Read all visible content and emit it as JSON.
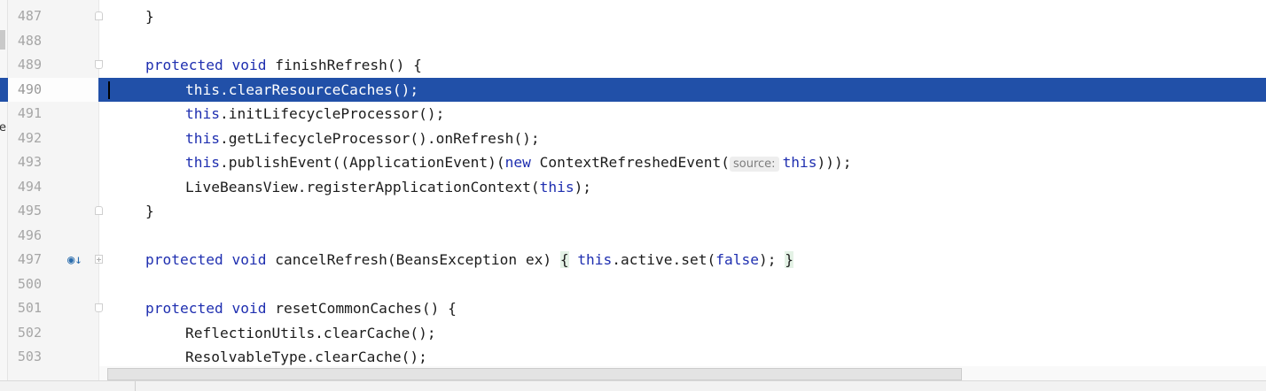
{
  "editor": {
    "lines": [
      {
        "num": "487",
        "fold": "close",
        "indent": 0,
        "tokens": [
          {
            "t": "}"
          }
        ]
      },
      {
        "num": "488",
        "fold": "",
        "indent": 0,
        "tokens": []
      },
      {
        "num": "489",
        "fold": "open",
        "indent": 0,
        "tokens": [
          {
            "t": "protected",
            "k": "kw"
          },
          {
            "t": " "
          },
          {
            "t": "void",
            "k": "kw"
          },
          {
            "t": " finishRefresh() {"
          }
        ]
      },
      {
        "num": "490",
        "fold": "",
        "indent": 1,
        "current": true,
        "tokens": [
          {
            "t": "this",
            "k": "kw"
          },
          {
            "t": ".clearResourceCaches();"
          }
        ]
      },
      {
        "num": "491",
        "fold": "",
        "indent": 1,
        "tokens": [
          {
            "t": "this",
            "k": "kw"
          },
          {
            "t": ".initLifecycleProcessor();"
          }
        ]
      },
      {
        "num": "492",
        "fold": "",
        "indent": 1,
        "tokens": [
          {
            "t": "this",
            "k": "kw"
          },
          {
            "t": ".getLifecycleProcessor().onRefresh();"
          }
        ]
      },
      {
        "num": "493",
        "fold": "",
        "indent": 1,
        "tokens": [
          {
            "t": "this",
            "k": "kw"
          },
          {
            "t": ".publishEvent((ApplicationEvent)("
          },
          {
            "t": "new",
            "k": "kw"
          },
          {
            "t": " ContextRefreshedEvent("
          },
          {
            "t": "source:",
            "k": "hint"
          },
          {
            "t": "this",
            "k": "kw"
          },
          {
            "t": ")));"
          }
        ]
      },
      {
        "num": "494",
        "fold": "",
        "indent": 1,
        "tokens": [
          {
            "t": "LiveBeansView.registerApplicationContext("
          },
          {
            "t": "this",
            "k": "kw"
          },
          {
            "t": ");"
          }
        ]
      },
      {
        "num": "495",
        "fold": "close",
        "indent": 0,
        "tokens": [
          {
            "t": "}"
          }
        ]
      },
      {
        "num": "496",
        "fold": "",
        "indent": 0,
        "tokens": []
      },
      {
        "num": "497",
        "fold": "plus",
        "indent": 0,
        "override": true,
        "tokens": [
          {
            "t": "protected",
            "k": "kw"
          },
          {
            "t": " "
          },
          {
            "t": "void",
            "k": "kw"
          },
          {
            "t": " cancelRefresh(BeansException ex) "
          },
          {
            "t": "{",
            "k": "brace"
          },
          {
            "t": " "
          },
          {
            "t": "this",
            "k": "kw"
          },
          {
            "t": ".active.set("
          },
          {
            "t": "false",
            "k": "kw"
          },
          {
            "t": "); "
          },
          {
            "t": "}",
            "k": "brace"
          }
        ]
      },
      {
        "num": "500",
        "fold": "",
        "indent": 0,
        "tokens": []
      },
      {
        "num": "501",
        "fold": "open",
        "indent": 0,
        "tokens": [
          {
            "t": "protected",
            "k": "kw"
          },
          {
            "t": " "
          },
          {
            "t": "void",
            "k": "kw"
          },
          {
            "t": " resetCommonCaches() {"
          }
        ]
      },
      {
        "num": "502",
        "fold": "",
        "indent": 1,
        "tokens": [
          {
            "t": "ReflectionUtils.clearCache();"
          }
        ]
      },
      {
        "num": "503",
        "fold": "",
        "indent": 1,
        "tokens": [
          {
            "t": "ResolvableType.clearCache();"
          }
        ]
      }
    ],
    "override_icon": "override-method-icon",
    "left_fragment": "e"
  },
  "colors": {
    "keyword": "#1f2fb0",
    "current_line": "#2150a8",
    "line_number": "#a6a6a6"
  }
}
